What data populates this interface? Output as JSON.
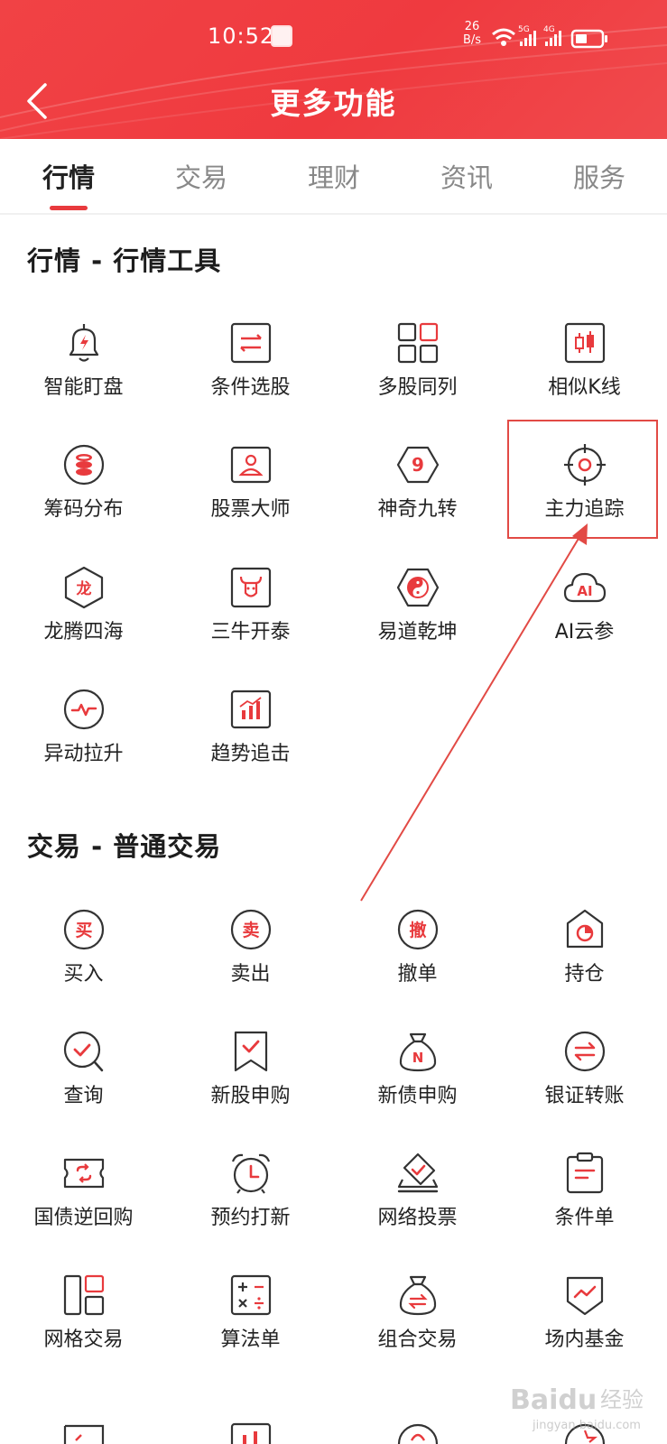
{
  "status_bar": {
    "time": "10:52",
    "speed_value": "26",
    "speed_unit": "B/s",
    "network_1": "5G",
    "network_2": "4G"
  },
  "nav": {
    "back_icon": "chevron-left-icon",
    "title": "更多功能"
  },
  "tabs": [
    {
      "label": "行情",
      "active": true
    },
    {
      "label": "交易",
      "active": false
    },
    {
      "label": "理财",
      "active": false
    },
    {
      "label": "资讯",
      "active": false
    },
    {
      "label": "服务",
      "active": false
    }
  ],
  "sections": [
    {
      "title": "行情 - 行情工具",
      "items": [
        {
          "label": "智能盯盘",
          "icon": "bell-icon"
        },
        {
          "label": "条件选股",
          "icon": "filter-board-icon"
        },
        {
          "label": "多股同列",
          "icon": "grid-icon"
        },
        {
          "label": "相似K线",
          "icon": "candlestick-icon"
        },
        {
          "label": "筹码分布",
          "icon": "coin-stack-icon"
        },
        {
          "label": "股票大师",
          "icon": "master-card-icon"
        },
        {
          "label": "神奇九转",
          "icon": "nine-hexagon-icon"
        },
        {
          "label": "主力追踪",
          "icon": "crosshair-icon"
        },
        {
          "label": "龙腾四海",
          "icon": "dragon-hexagon-icon"
        },
        {
          "label": "三牛开泰",
          "icon": "bull-icon"
        },
        {
          "label": "易道乾坤",
          "icon": "yinyang-icon"
        },
        {
          "label": "AI云参",
          "icon": "ai-cloud-icon"
        },
        {
          "label": "异动拉升",
          "icon": "pulse-icon"
        },
        {
          "label": "趋势追击",
          "icon": "bar-trend-icon"
        }
      ]
    },
    {
      "title": "交易 - 普通交易",
      "items": [
        {
          "label": "买入",
          "icon": "buy-icon",
          "glyph": "买"
        },
        {
          "label": "卖出",
          "icon": "sell-icon",
          "glyph": "卖"
        },
        {
          "label": "撤单",
          "icon": "cancel-order-icon",
          "glyph": "撤"
        },
        {
          "label": "持仓",
          "icon": "position-pie-icon"
        },
        {
          "label": "查询",
          "icon": "search-check-icon"
        },
        {
          "label": "新股申购",
          "icon": "bookmark-check-icon"
        },
        {
          "label": "新债申购",
          "icon": "money-bag-n-icon"
        },
        {
          "label": "银证转账",
          "icon": "transfer-icon"
        },
        {
          "label": "国债逆回购",
          "icon": "ticket-icon"
        },
        {
          "label": "预约打新",
          "icon": "alarm-clock-icon"
        },
        {
          "label": "网络投票",
          "icon": "vote-icon"
        },
        {
          "label": "条件单",
          "icon": "clipboard-icon"
        },
        {
          "label": "网格交易",
          "icon": "grid-layout-icon"
        },
        {
          "label": "算法单",
          "icon": "calculator-icon"
        },
        {
          "label": "组合交易",
          "icon": "money-bag-icon"
        },
        {
          "label": "场内基金",
          "icon": "fund-shield-icon"
        }
      ]
    }
  ],
  "annotation": {
    "highlighted_item": "主力追踪",
    "color": "#e24a45"
  },
  "watermark": {
    "text_brand": "Baidu",
    "text_cn": "经验",
    "text_url": "jingyan.baidu.com"
  },
  "colors": {
    "brand_red": "#ef3a3f",
    "icon_red": "#e83a3d",
    "icon_dark": "#333333",
    "tab_inactive": "#888888"
  }
}
